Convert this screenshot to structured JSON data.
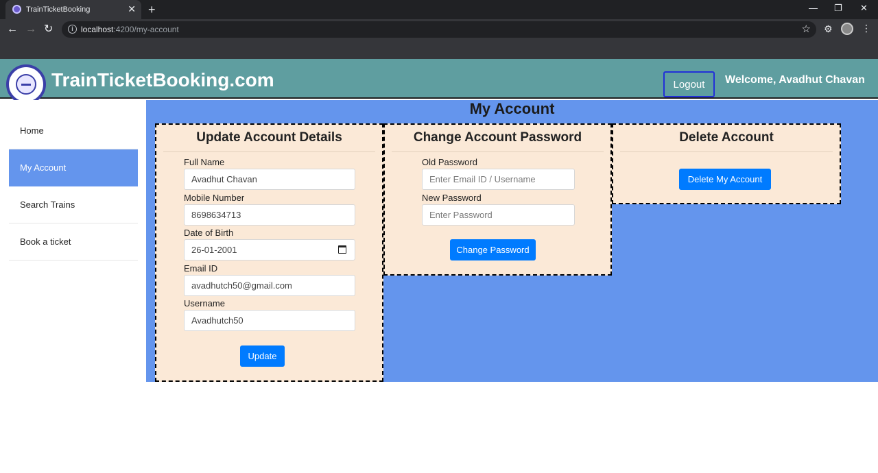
{
  "browser": {
    "tab_title": "TrainTicketBooking",
    "tab_close": "✕",
    "new_tab": "+",
    "url_host": "localhost",
    "url_path": ":4200/my-account",
    "minimize": "—",
    "maximize": "❐",
    "close": "✕"
  },
  "header": {
    "brand": "TrainTicketBooking.com",
    "logout_label": "Logout",
    "welcome": "Welcome, Avadhut Chavan"
  },
  "sidebar": {
    "items": [
      {
        "label": "Home",
        "active": false
      },
      {
        "label": "My Account",
        "active": true
      },
      {
        "label": "Search Trains",
        "active": false
      },
      {
        "label": "Book a ticket",
        "active": false
      }
    ]
  },
  "main": {
    "title": "My Account",
    "update_card": {
      "title": "Update Account Details",
      "full_name_label": "Full Name",
      "full_name_value": "Avadhut Chavan",
      "mobile_label": "Mobile Number",
      "mobile_value": "8698634713",
      "dob_label": "Date of Birth",
      "dob_value": "26-01-2001",
      "email_label": "Email ID",
      "email_value": "avadhutch50@gmail.com",
      "username_label": "Username",
      "username_value": "Avadhutch50",
      "submit_label": "Update"
    },
    "password_card": {
      "title": "Change Account Password",
      "old_label": "Old Password",
      "old_placeholder": "Enter Email ID / Username",
      "new_label": "New Password",
      "new_placeholder": "Enter Password",
      "submit_label": "Change Password"
    },
    "delete_card": {
      "title": "Delete Account",
      "submit_label": "Delete My Account"
    }
  },
  "colors": {
    "header_bg": "#5f9ea0",
    "main_bg": "#6495ed",
    "card_bg": "#fbe9d7",
    "primary": "#007bff"
  }
}
